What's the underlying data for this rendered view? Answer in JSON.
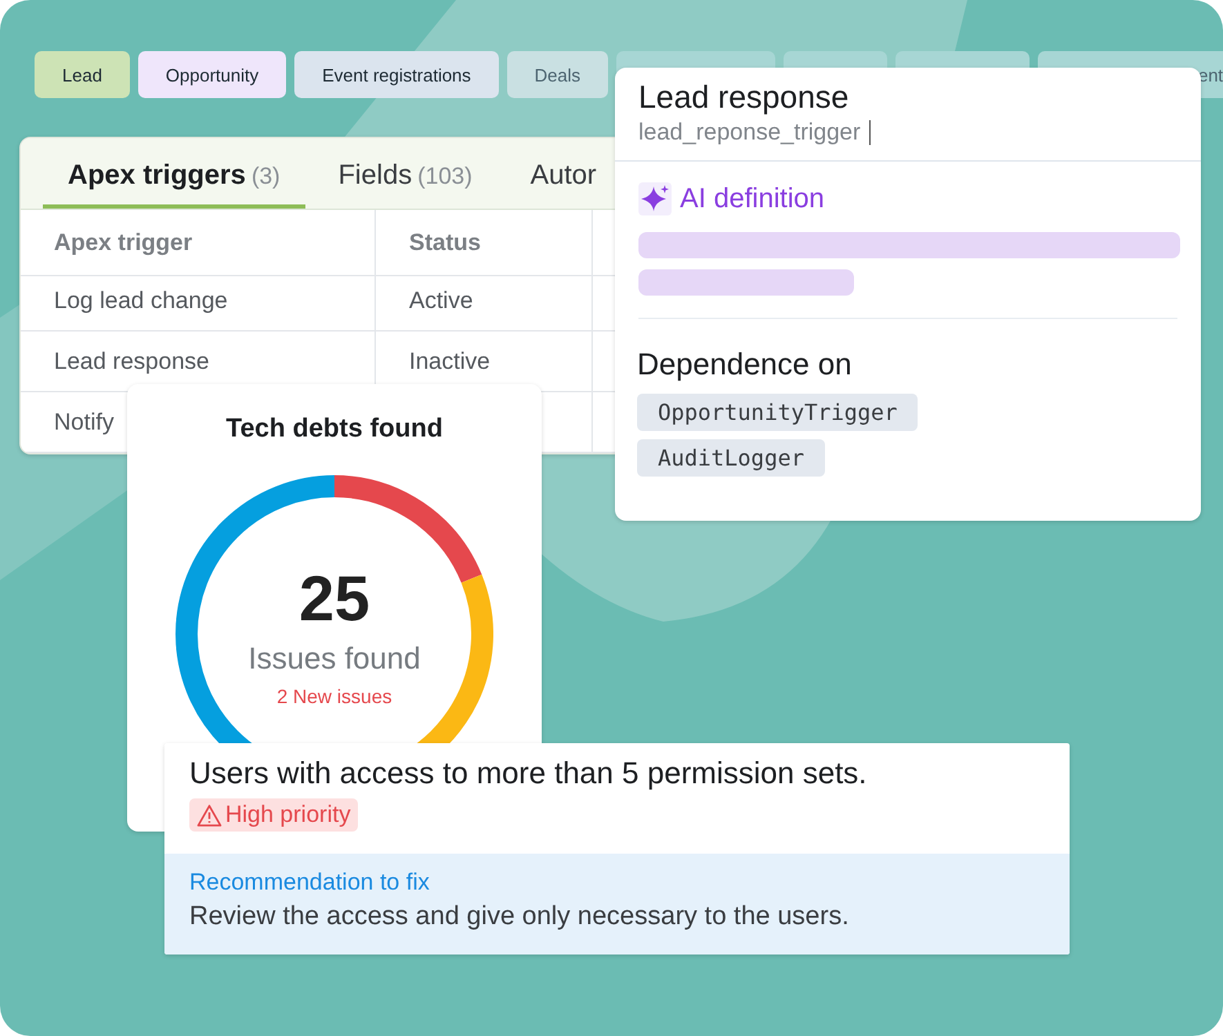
{
  "chips": [
    {
      "label": "Lead",
      "color": "#cde3b5"
    },
    {
      "label": "Opportunity",
      "color": "#efe6fb"
    },
    {
      "label": "Event registrations",
      "color": "#dbe4ee"
    },
    {
      "label": "Deals",
      "color": "#c9e0e2"
    },
    {
      "color": "#a7d6d4"
    },
    {
      "color": "#a7d6d4"
    },
    {
      "color": "#a7d6d4"
    },
    {
      "label": "ent",
      "color": "#a7d6d4"
    }
  ],
  "table_card": {
    "tabs": [
      {
        "label": "Apex triggers",
        "count": "(3)",
        "selected": true
      },
      {
        "label": "Fields",
        "count": "(103)",
        "selected": false
      },
      {
        "label": "Autor",
        "selected": false
      }
    ],
    "columns": [
      "Apex trigger",
      "Status"
    ],
    "rows": [
      [
        "Log lead change",
        "Active"
      ],
      [
        "Lead response",
        "Inactive"
      ],
      [
        "Notify"
      ]
    ]
  },
  "tech_debts": {
    "title": "Tech debts found",
    "count": "25",
    "label": "Issues found",
    "new_issues": "2 New issues"
  },
  "trigger_detail": {
    "title": "Lead response",
    "api_name": "lead_reponse_trigger",
    "ai_definition": "AI definition",
    "dependence_title": "Dependence on",
    "dependencies": [
      "OpportunityTrigger",
      "AuditLogger"
    ]
  },
  "recommendation": {
    "issue": "Users with access to more than 5 permission sets.",
    "priority": "High priority",
    "fix_label": "Recommendation to fix",
    "fix_text": "Review the access and give only necessary to the users."
  }
}
